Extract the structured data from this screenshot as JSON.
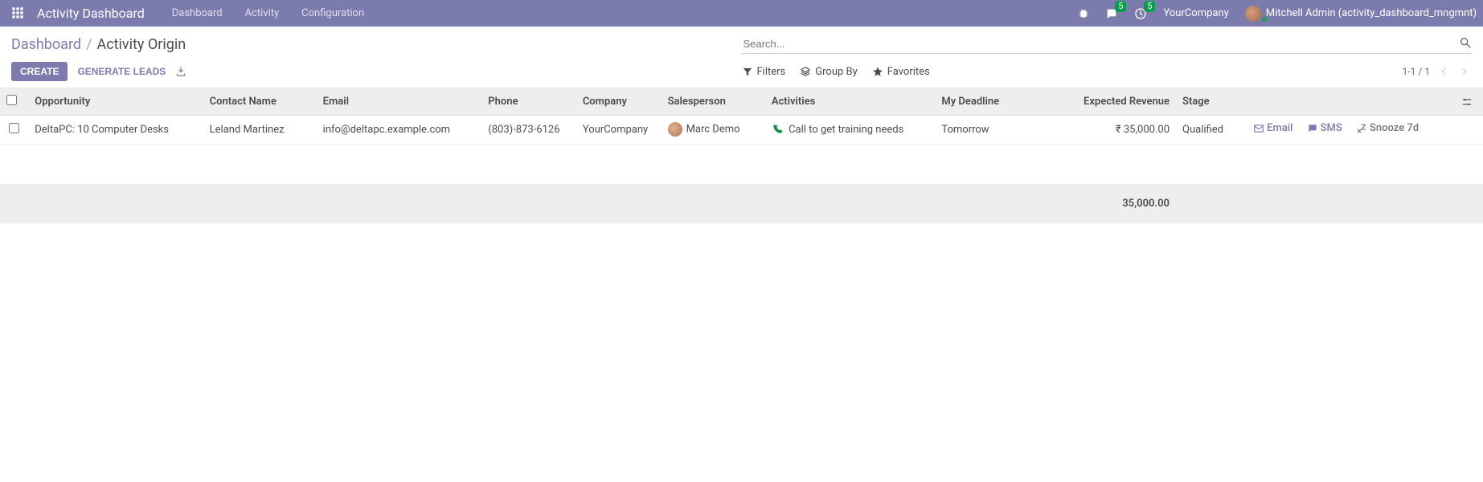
{
  "navbar": {
    "brand": "Activity Dashboard",
    "menu": [
      "Dashboard",
      "Activity",
      "Configuration"
    ],
    "messages_badge": "5",
    "activities_badge": "5",
    "company": "YourCompany",
    "user": "Mitchell Admin (activity_dashboard_mngmnt)"
  },
  "control": {
    "breadcrumb_parent": "Dashboard",
    "breadcrumb_current": "Activity Origin",
    "create_label": "CREATE",
    "generate_label": "GENERATE LEADS",
    "search_placeholder": "Search...",
    "filters_label": "Filters",
    "groupby_label": "Group By",
    "favorites_label": "Favorites",
    "pager": "1-1 / 1"
  },
  "table": {
    "headers": {
      "opportunity": "Opportunity",
      "contact": "Contact Name",
      "email": "Email",
      "phone": "Phone",
      "company": "Company",
      "salesperson": "Salesperson",
      "activities": "Activities",
      "deadline": "My Deadline",
      "revenue": "Expected Revenue",
      "stage": "Stage"
    },
    "row": {
      "opportunity": "DeltaPC: 10 Computer Desks",
      "contact": "Leland Martinez",
      "email": "info@deltapc.example.com",
      "phone": "(803)-873-6126",
      "company": "YourCompany",
      "salesperson": "Marc Demo",
      "activities": "Call to get training needs",
      "deadline": "Tomorrow",
      "revenue": "₹ 35,000.00",
      "stage": "Qualified",
      "action_email": "Email",
      "action_sms": "SMS",
      "action_snooze": "Snooze 7d"
    },
    "footer_total": "35,000.00"
  }
}
